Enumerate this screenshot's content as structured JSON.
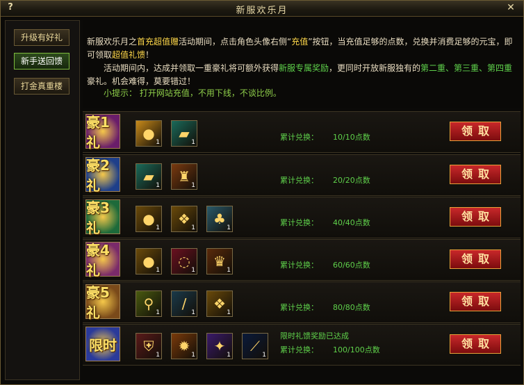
{
  "window": {
    "title": "新服欢乐月",
    "help_label": "?",
    "close_label": "✕"
  },
  "sidebar": {
    "items": [
      {
        "label": "升级有好礼",
        "active": false
      },
      {
        "label": "新手送回馈",
        "active": true
      },
      {
        "label": "打金真重楼",
        "active": false
      }
    ]
  },
  "intro": {
    "p1_a": "新服欢乐月之",
    "p1_b": "首充超值赠",
    "p1_c": "活动期间，点击角色头像右侧“",
    "p1_d": "充值",
    "p1_e": "”按钮，当充值足够的点数，兑换并消费足够的元宝，即可领取",
    "p1_f": "超值礼馈",
    "p1_g": "！",
    "p2_a": "活动期间内，达成并领取一重豪礼将可额外获得",
    "p2_b": "新服专属奖励",
    "p2_c": "，更同时开放新服独有的",
    "p2_d": "第二重、第三重、第四重",
    "p2_e": "豪礼。机会难得，莫要错过！",
    "tip": "小提示：  打开网站充值，不用下线，不谈比例。"
  },
  "rows": [
    {
      "badge": "豪1礼",
      "status": "",
      "label": "累计兑换：",
      "value": "10/10点数",
      "button": "领取",
      "items": [
        {
          "icon": "gold-bag-icon",
          "count": "1"
        },
        {
          "icon": "red-scroll-icon",
          "count": "1"
        }
      ]
    },
    {
      "badge": "豪2礼",
      "status": "",
      "label": "累计兑换：",
      "value": "20/20点数",
      "button": "领取",
      "items": [
        {
          "icon": "red-scroll-icon",
          "count": "1"
        },
        {
          "icon": "golden-armor-icon",
          "count": "1"
        }
      ]
    },
    {
      "badge": "豪3礼",
      "status": "",
      "label": "累计兑换：",
      "value": "40/40点数",
      "button": "领取",
      "items": [
        {
          "icon": "gold-orb-icon",
          "count": "1"
        },
        {
          "icon": "gold-token-icon",
          "count": "1"
        },
        {
          "icon": "jade-treasure-icon",
          "count": "1"
        }
      ]
    },
    {
      "badge": "豪4礼",
      "status": "",
      "label": "累计兑换：",
      "value": "60/60点数",
      "button": "领取",
      "items": [
        {
          "icon": "gold-orb-icon",
          "count": "1"
        },
        {
          "icon": "red-necklace-icon",
          "count": "1"
        },
        {
          "icon": "gold-helmet-icon",
          "count": "1"
        }
      ]
    },
    {
      "badge": "豪5礼",
      "status": "",
      "label": "累计兑换：",
      "value": "80/80点数",
      "button": "领取",
      "items": [
        {
          "icon": "green-robe-icon",
          "count": "1"
        },
        {
          "icon": "sword-icon",
          "count": "1"
        },
        {
          "icon": "gold-token-icon",
          "count": "1"
        }
      ]
    },
    {
      "badge": "限时",
      "status": "限时礼馈奖励已达成",
      "label": "累计兑换：",
      "value": "100/100点数",
      "button": "领取",
      "items": [
        {
          "icon": "shield-crest-icon",
          "count": "1"
        },
        {
          "icon": "fire-rune-icon",
          "count": "1"
        },
        {
          "icon": "purple-dragon-icon",
          "count": "1"
        },
        {
          "icon": "blue-spear-icon",
          "count": "1"
        }
      ]
    }
  ]
}
